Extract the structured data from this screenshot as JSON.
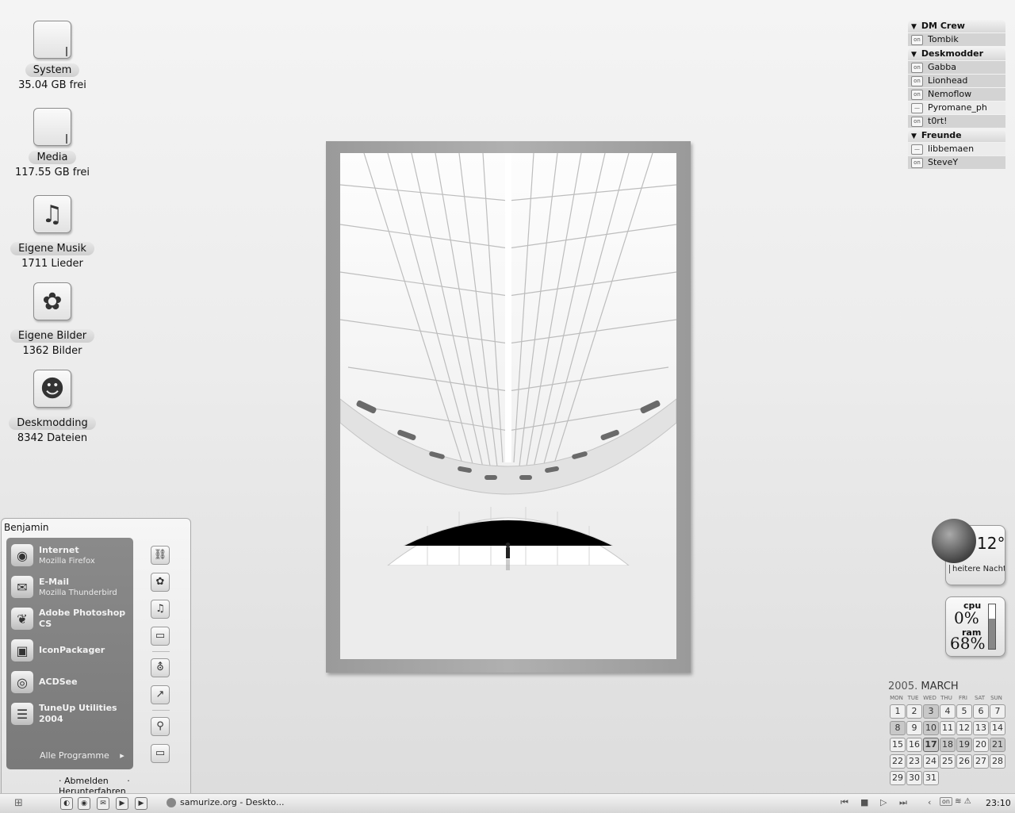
{
  "desktop_icons": [
    {
      "label": "System",
      "sub": "35.04 GB frei",
      "icon": "drive-icon"
    },
    {
      "label": "Media",
      "sub": "117.55 GB frei",
      "icon": "drive-icon"
    },
    {
      "label": "Eigene Musik",
      "sub": "1711 Lieder",
      "icon": "music-note-icon"
    },
    {
      "label": "Eigene Bilder",
      "sub": "1362 Bilder",
      "icon": "tulip-icon"
    },
    {
      "label": "Deskmodding",
      "sub": "8342 Dateien",
      "icon": "monkey-icon"
    }
  ],
  "buddy_list": {
    "groups": [
      {
        "name": "DM Crew",
        "members": [
          {
            "name": "Tombik",
            "status": "on"
          }
        ]
      },
      {
        "name": "Deskmodder",
        "members": [
          {
            "name": "Gabba",
            "status": "on"
          },
          {
            "name": "Lionhead",
            "status": "on"
          },
          {
            "name": "Nemoflow",
            "status": "on"
          },
          {
            "name": "Pyromane_ph",
            "status": "away"
          },
          {
            "name": "t0rt!",
            "status": "on"
          }
        ]
      },
      {
        "name": "Freunde",
        "members": [
          {
            "name": "libbemaen",
            "status": "away"
          },
          {
            "name": "SteveY",
            "status": "on"
          }
        ]
      }
    ]
  },
  "start_menu": {
    "user": "Benjamin",
    "programs": [
      {
        "title": "Internet",
        "sub": "Mozilla Firefox",
        "icon": "firefox-icon"
      },
      {
        "title": "E-Mail",
        "sub": "Mozilla Thunderbird",
        "icon": "thunderbird-icon"
      },
      {
        "title": "Adobe Photoshop",
        "sub": "CS",
        "icon": "photoshop-icon"
      },
      {
        "title": "IconPackager",
        "sub": "",
        "icon": "iconpackager-icon"
      },
      {
        "title": "ACDSee",
        "sub": "",
        "icon": "eye-icon"
      },
      {
        "title": "TuneUp Utilities",
        "sub": "2004",
        "icon": "tuneup-icon"
      }
    ],
    "all_programs": "Alle Programme",
    "logoff": "Abmelden",
    "shutdown": "Herunterfahren"
  },
  "weather": {
    "temperature": "12°",
    "condition": "heitere Nacht"
  },
  "sysmon": {
    "cpu_label": "cpu",
    "cpu_value": "0%",
    "ram_label": "ram",
    "ram_value": "68%",
    "ram_fraction": 0.68
  },
  "calendar": {
    "year": "2005.",
    "month": "MARCH",
    "weekdays": [
      "MON",
      "TUE",
      "WED",
      "THU",
      "FRI",
      "SAT",
      "SUN"
    ],
    "days": [
      "1",
      "2",
      "3",
      "4",
      "5",
      "6",
      "7",
      "8",
      "9",
      "10",
      "11",
      "12",
      "13",
      "14",
      "15",
      "16",
      "17",
      "18",
      "19",
      "20",
      "21",
      "22",
      "23",
      "24",
      "25",
      "26",
      "27",
      "28",
      "29",
      "30",
      "31"
    ],
    "first_weekday_index": 1,
    "today": "17"
  },
  "taskbar": {
    "active_window": "samurize.org - Deskto...",
    "tray_status": "on",
    "clock": "23:10"
  }
}
